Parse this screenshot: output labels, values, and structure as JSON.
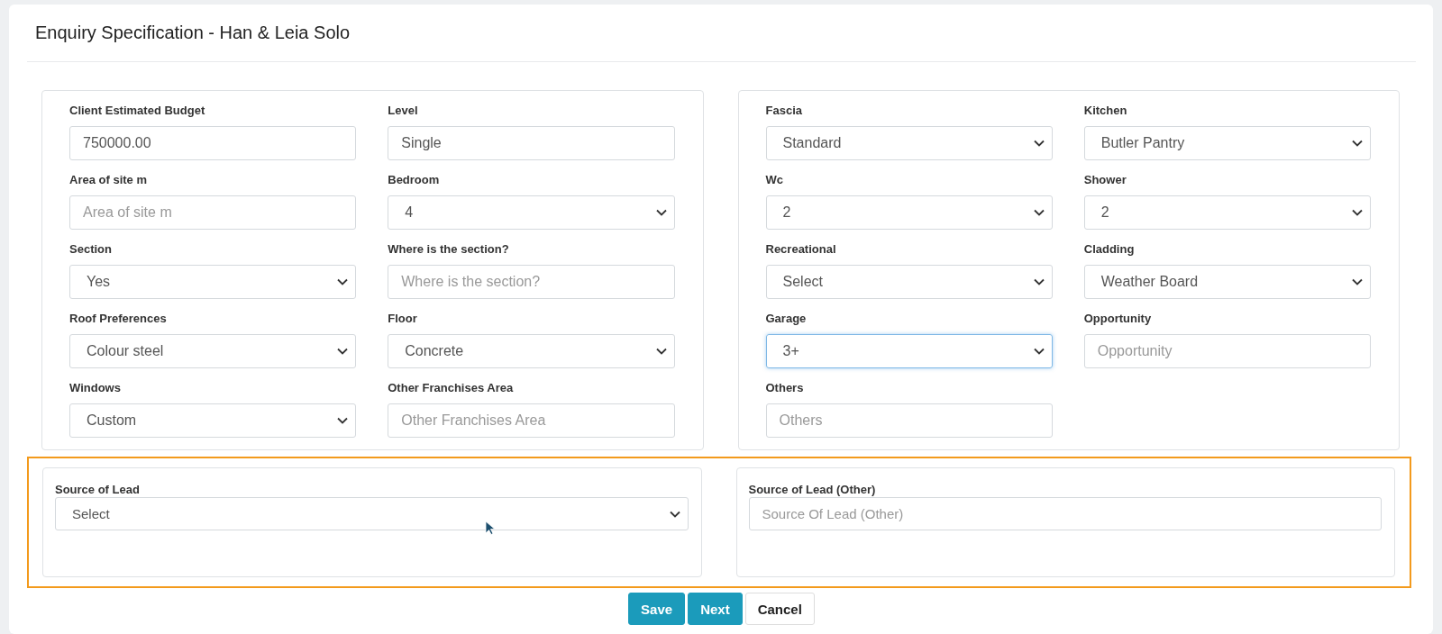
{
  "title": "Enquiry Specification - Han & Leia Solo",
  "panels": [
    {
      "fields": [
        {
          "label": "Client Estimated Budget",
          "kind": "input",
          "value": "750000.00",
          "focused": false
        },
        {
          "label": "Level",
          "kind": "input",
          "value": "Single",
          "focused": false
        },
        {
          "label": "Area of site m",
          "kind": "input",
          "placeholder": "Area of site m",
          "focused": false
        },
        {
          "label": "Bedroom",
          "kind": "select",
          "value": "4",
          "focused": false
        },
        {
          "label": "Section",
          "kind": "select",
          "value": "Yes",
          "focused": false
        },
        {
          "label": "Where is the section?",
          "kind": "input",
          "placeholder": "Where is the section?",
          "focused": false
        },
        {
          "label": "Roof Preferences",
          "kind": "select",
          "value": "Colour steel",
          "focused": false
        },
        {
          "label": "Floor",
          "kind": "select",
          "value": "Concrete",
          "focused": false
        },
        {
          "label": "Windows",
          "kind": "select",
          "value": "Custom",
          "focused": false
        },
        {
          "label": "Other Franchises Area",
          "kind": "input",
          "placeholder": "Other Franchises Area",
          "focused": false
        }
      ]
    },
    {
      "fields": [
        {
          "label": "Fascia",
          "kind": "select",
          "value": "Standard",
          "focused": false
        },
        {
          "label": "Kitchen",
          "kind": "select",
          "value": "Butler Pantry",
          "focused": false
        },
        {
          "label": "Wc",
          "kind": "select",
          "value": "2",
          "focused": false
        },
        {
          "label": "Shower",
          "kind": "select",
          "value": "2",
          "focused": false
        },
        {
          "label": "Recreational",
          "kind": "select",
          "value": "Select",
          "focused": false
        },
        {
          "label": "Cladding",
          "kind": "select",
          "value": "Weather Board",
          "focused": false
        },
        {
          "label": "Garage",
          "kind": "select",
          "value": "3+",
          "focused": true
        },
        {
          "label": "Opportunity",
          "kind": "input",
          "placeholder": "Opportunity",
          "focused": false
        },
        {
          "label": "Others",
          "kind": "input",
          "placeholder": "Others",
          "focused": false
        }
      ]
    }
  ],
  "lead_section": {
    "highlighted": true,
    "fields": [
      {
        "label": "Source of Lead",
        "kind": "select",
        "value": "Select",
        "focused": false
      },
      {
        "label": "Source of Lead (Other)",
        "kind": "input",
        "placeholder": "Source Of Lead (Other)",
        "focused": false
      }
    ]
  },
  "buttons": [
    {
      "label": "Save",
      "kind": "primary"
    },
    {
      "label": "Next",
      "kind": "primary"
    },
    {
      "label": "Cancel",
      "kind": "default"
    }
  ]
}
